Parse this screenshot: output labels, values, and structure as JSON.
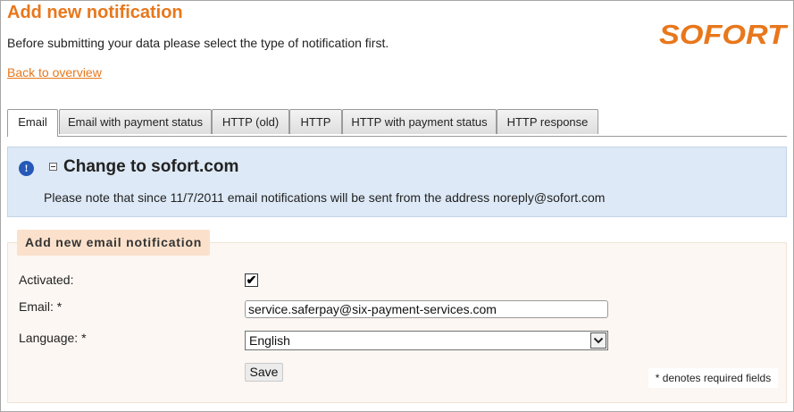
{
  "header": {
    "title": "Add new notification",
    "intro": "Before submitting your data please select the type of notification first.",
    "back_link": "Back to overview",
    "logo_text": "SOFORT",
    "brand_color": "#e8771c"
  },
  "tabs": [
    {
      "label": "Email",
      "active": true
    },
    {
      "label": "Email with payment status",
      "active": false
    },
    {
      "label": "HTTP (old)",
      "active": false
    },
    {
      "label": "HTTP",
      "active": false
    },
    {
      "label": "HTTP with payment status",
      "active": false
    },
    {
      "label": "HTTP response",
      "active": false
    }
  ],
  "notice": {
    "icon": "info-icon",
    "toggle_icon": "collapse-icon",
    "title": "Change to sofort.com",
    "text": "Please note that since 11/7/2011 email notifications will be sent from the address noreply@sofort.com"
  },
  "form": {
    "legend": "Add new email notification",
    "activated_label": "Activated:",
    "activated_checked": true,
    "email_label": "Email: *",
    "email_value": "service.saferpay@six-payment-services.com",
    "language_label": "Language: *",
    "language_value": "English",
    "save_label": "Save",
    "required_note": "* denotes required fields"
  }
}
